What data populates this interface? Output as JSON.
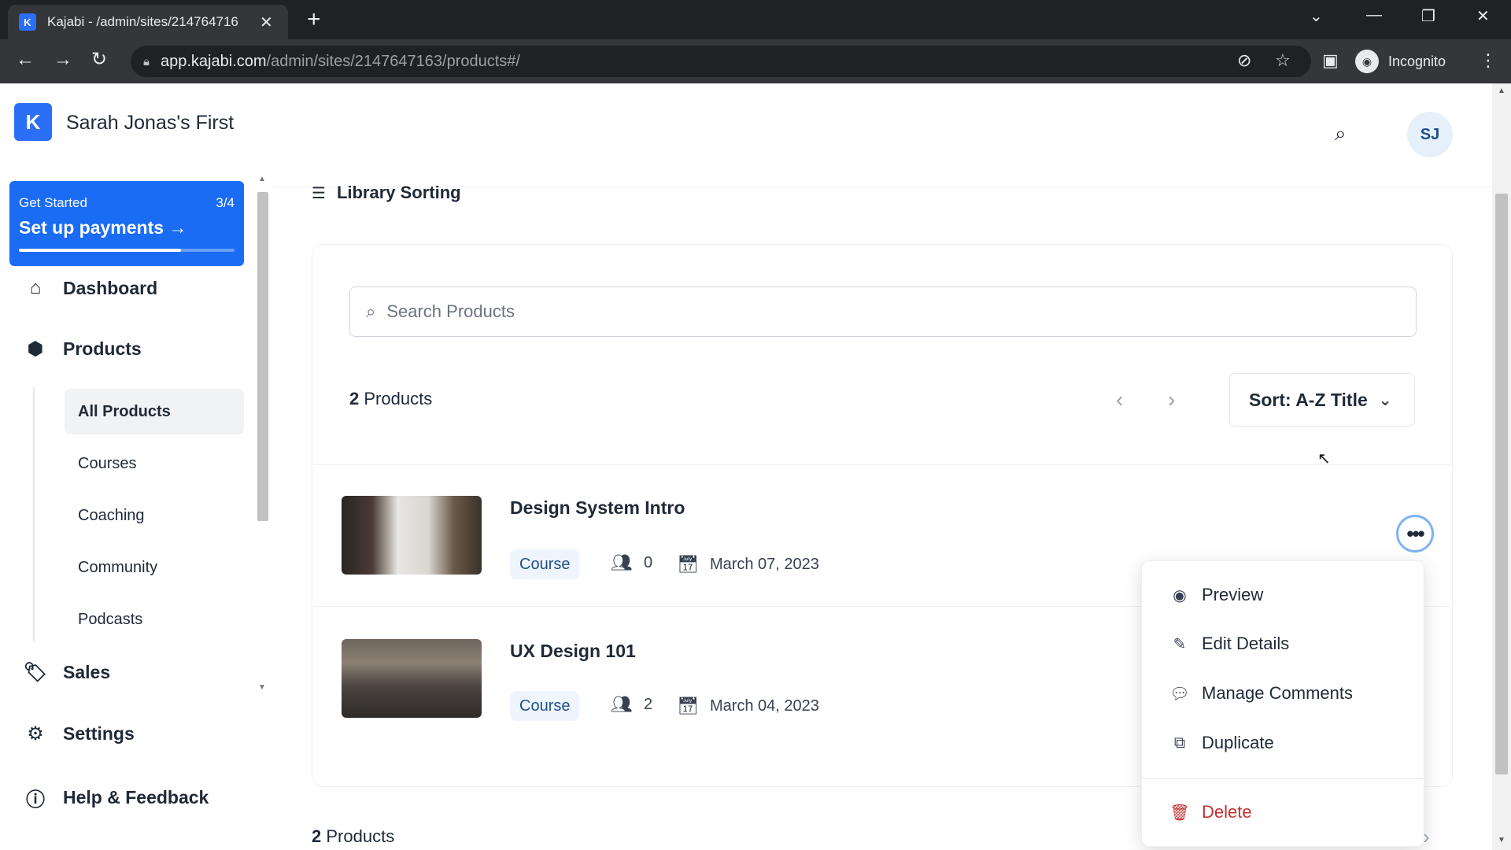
{
  "browser": {
    "tab_title": "Kajabi - /admin/sites/214764716",
    "tab_favicon": "K",
    "url_host": "app.kajabi.com",
    "url_path": "/admin/sites/2147647163/products#/",
    "incognito_label": "Incognito"
  },
  "sidebar": {
    "site_name": "Sarah Jonas's First",
    "logo_letter": "K",
    "get_started": {
      "label": "Get Started",
      "count": "3/4",
      "title": "Set up payments",
      "progress": 0.75
    },
    "nav": {
      "dashboard": "Dashboard",
      "products": "Products",
      "sales": "Sales",
      "settings": "Settings",
      "help": "Help & Feedback"
    },
    "products_sub": [
      "All Products",
      "Courses",
      "Coaching",
      "Community",
      "Podcasts"
    ]
  },
  "header": {
    "avatar_initials": "SJ"
  },
  "main": {
    "library_sorting": "Library Sorting",
    "search_placeholder": "Search Products",
    "count_number": "2",
    "count_label": "Products",
    "sort_label": "Sort: A-Z Title",
    "products": [
      {
        "title": "Design System Intro",
        "type": "Course",
        "members": "0",
        "date": "March 07, 2023"
      },
      {
        "title": "UX Design 101",
        "type": "Course",
        "members": "2",
        "date": "March 04, 2023"
      }
    ],
    "bottom_count_number": "2",
    "bottom_count_label": "Products"
  },
  "menu": {
    "preview": "Preview",
    "edit_details": "Edit Details",
    "manage_comments": "Manage Comments",
    "duplicate": "Duplicate",
    "delete": "Delete"
  },
  "colors": {
    "brand": "#2b6ff7",
    "banner": "#1a6cf5",
    "danger": "#c53030",
    "badge_bg": "#eef5fc",
    "badge_text": "#1f4e8c"
  },
  "icons": {
    "search": "search-icon",
    "home": "home-icon",
    "products": "box-icon",
    "sales": "tag-icon",
    "settings": "gear-icon",
    "help": "question-icon",
    "members": "users-icon",
    "calendar": "calendar-icon"
  }
}
